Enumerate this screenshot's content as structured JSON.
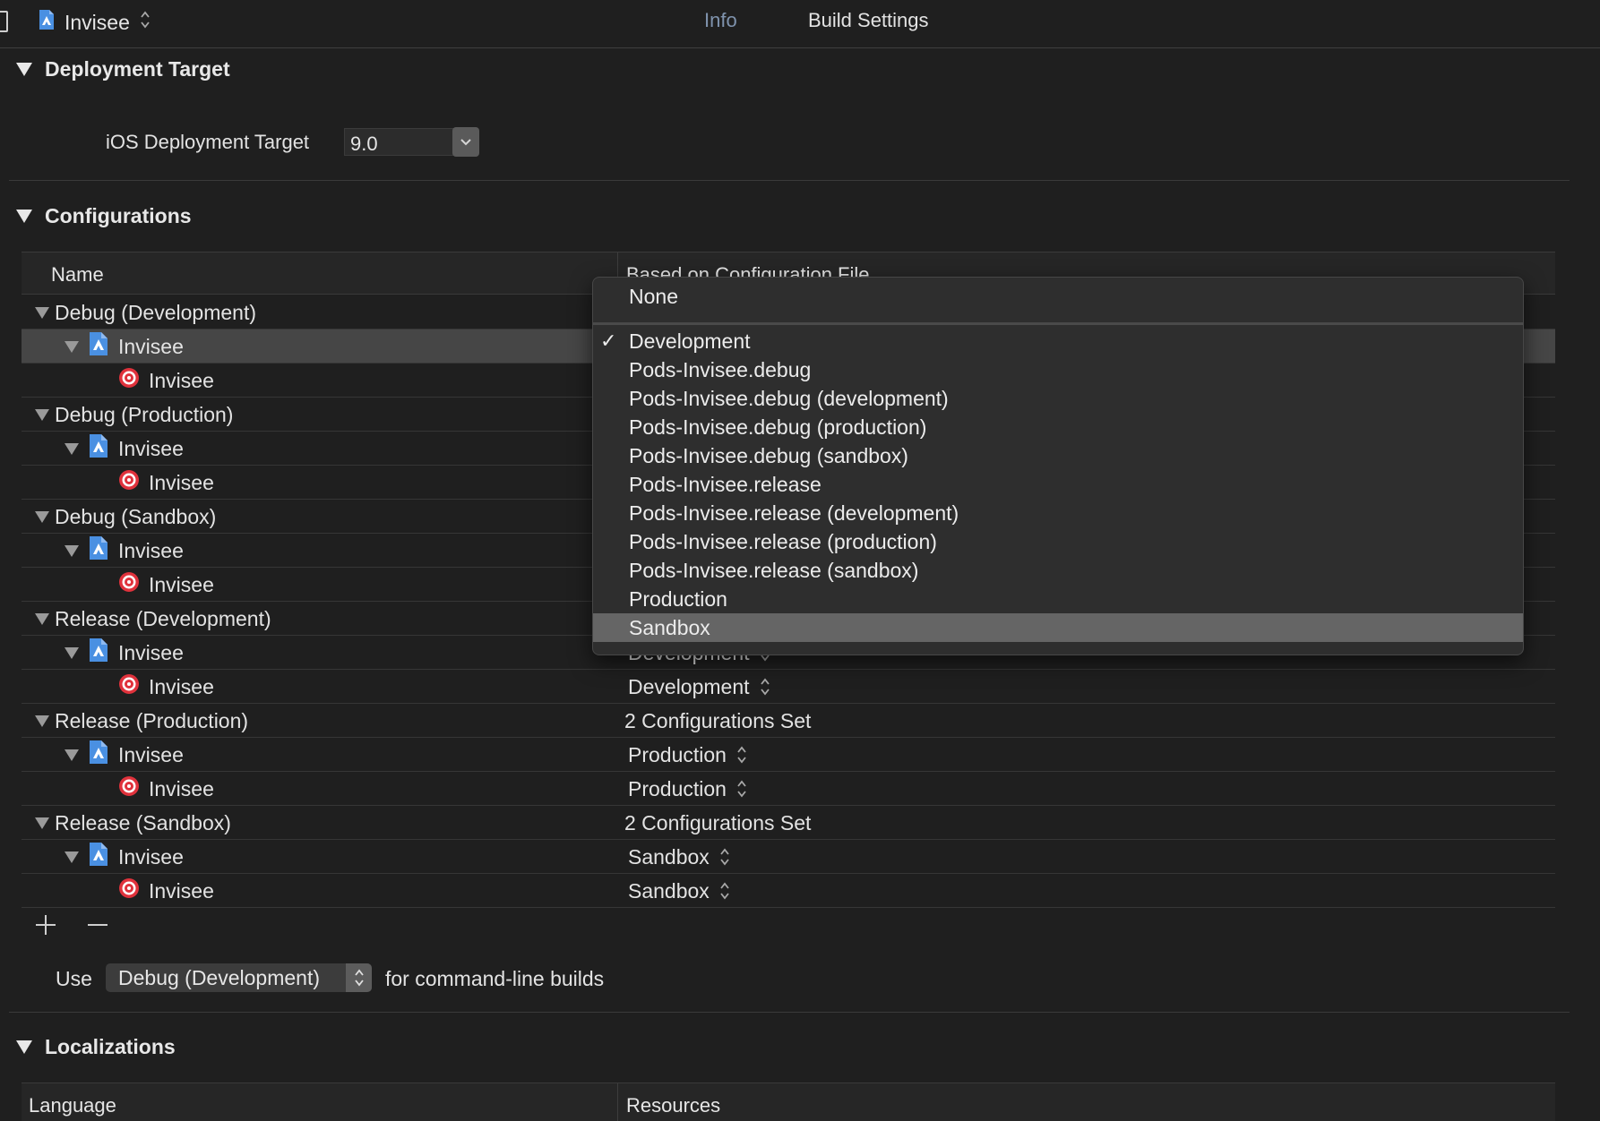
{
  "topbar": {
    "target_name": "Invisee",
    "tabs": [
      {
        "label": "Info"
      },
      {
        "label": "Build Settings"
      }
    ]
  },
  "deployment": {
    "title": "Deployment Target",
    "field_label": "iOS Deployment Target",
    "value": "9.0"
  },
  "configurations": {
    "title": "Configurations",
    "col_name": "Name",
    "col_based_on": "Based on Configuration File",
    "rows": [
      {
        "name": "Debug (Development)",
        "value": ""
      },
      {
        "name": "Invisee",
        "value": ""
      },
      {
        "name": "Invisee",
        "value": ""
      },
      {
        "name": "Debug (Production)",
        "value": ""
      },
      {
        "name": "Invisee",
        "value": ""
      },
      {
        "name": "Invisee",
        "value": ""
      },
      {
        "name": "Debug (Sandbox)",
        "value": ""
      },
      {
        "name": "Invisee",
        "value": ""
      },
      {
        "name": "Invisee",
        "value": ""
      },
      {
        "name": "Release (Development)",
        "value": ""
      },
      {
        "name": "Invisee",
        "value": "Development"
      },
      {
        "name": "Invisee",
        "value": "Development"
      },
      {
        "name": "Release (Production)",
        "value": "2 Configurations Set"
      },
      {
        "name": "Invisee",
        "value": "Production"
      },
      {
        "name": "Invisee",
        "value": "Production"
      },
      {
        "name": "Release (Sandbox)",
        "value": "2 Configurations Set"
      },
      {
        "name": "Invisee",
        "value": "Sandbox"
      },
      {
        "name": "Invisee",
        "value": "Sandbox"
      }
    ],
    "use_label": "Use",
    "command_line_config": "Debug (Development)",
    "command_line_suffix": "for command-line builds"
  },
  "dropdown": {
    "options": [
      "None",
      "Development",
      "Pods-Invisee.debug",
      "Pods-Invisee.debug (development)",
      "Pods-Invisee.debug (production)",
      "Pods-Invisee.debug (sandbox)",
      "Pods-Invisee.release",
      "Pods-Invisee.release (development)",
      "Pods-Invisee.release (production)",
      "Pods-Invisee.release (sandbox)",
      "Production",
      "Sandbox"
    ],
    "checked": "Development",
    "highlighted": "Sandbox"
  },
  "localizations": {
    "title": "Localizations",
    "col_language": "Language",
    "col_resources": "Resources"
  },
  "colors": {
    "background": "#1f1f1f",
    "selected_row": "#464646",
    "menu_background": "#2e2e2e",
    "menu_highlight": "#656565",
    "target_icon_red": "#e0323c",
    "app_icon_blue": "#4a90e2",
    "info_tab": "#7f93ad"
  }
}
